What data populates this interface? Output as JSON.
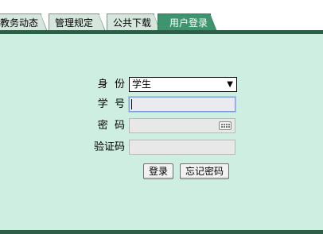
{
  "tabs": [
    {
      "label": "教务动态"
    },
    {
      "label": "管理规定"
    },
    {
      "label": "公共下载"
    },
    {
      "label": "用户登录",
      "active": true
    }
  ],
  "form": {
    "identity_label": "身  份",
    "identity_value": "学生",
    "student_id_label": "学  号",
    "student_id_value": "",
    "password_label": "密  码",
    "password_value": "",
    "captcha_label": "验证码",
    "captcha_value": "",
    "login_button": "登录",
    "forgot_button": "忘记密码"
  },
  "colors": {
    "panel_bg": "#cdeee0",
    "active_tab": "#3f9470",
    "border_dark": "#2d5e47"
  }
}
